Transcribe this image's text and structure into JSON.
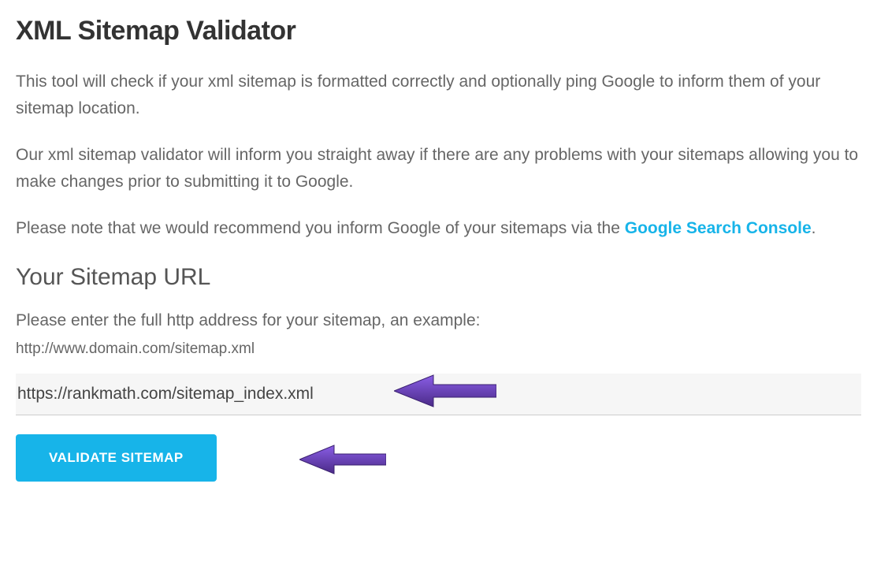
{
  "title": "XML Sitemap Validator",
  "paragraph1": "This tool will check if your xml sitemap is formatted correctly and optionally ping Google to inform them of your sitemap location.",
  "paragraph2": "Our xml sitemap validator will inform you straight away if there are any problems with your sitemaps allowing you to make changes prior to submitting it to Google.",
  "paragraph3_prefix": "Please note that we would recommend you inform Google of your sitemaps via the ",
  "paragraph3_link": "Google Search Console",
  "paragraph3_suffix": ".",
  "subheading": "Your Sitemap URL",
  "hint": "Please enter the full http address for your sitemap, an example:",
  "example": "http://www.domain.com/sitemap.xml",
  "input_value": "https://rankmath.com/sitemap_index.xml",
  "button_label": "VALIDATE SITEMAP",
  "colors": {
    "accent": "#17b4e9",
    "arrow": "#6a3bbf"
  }
}
